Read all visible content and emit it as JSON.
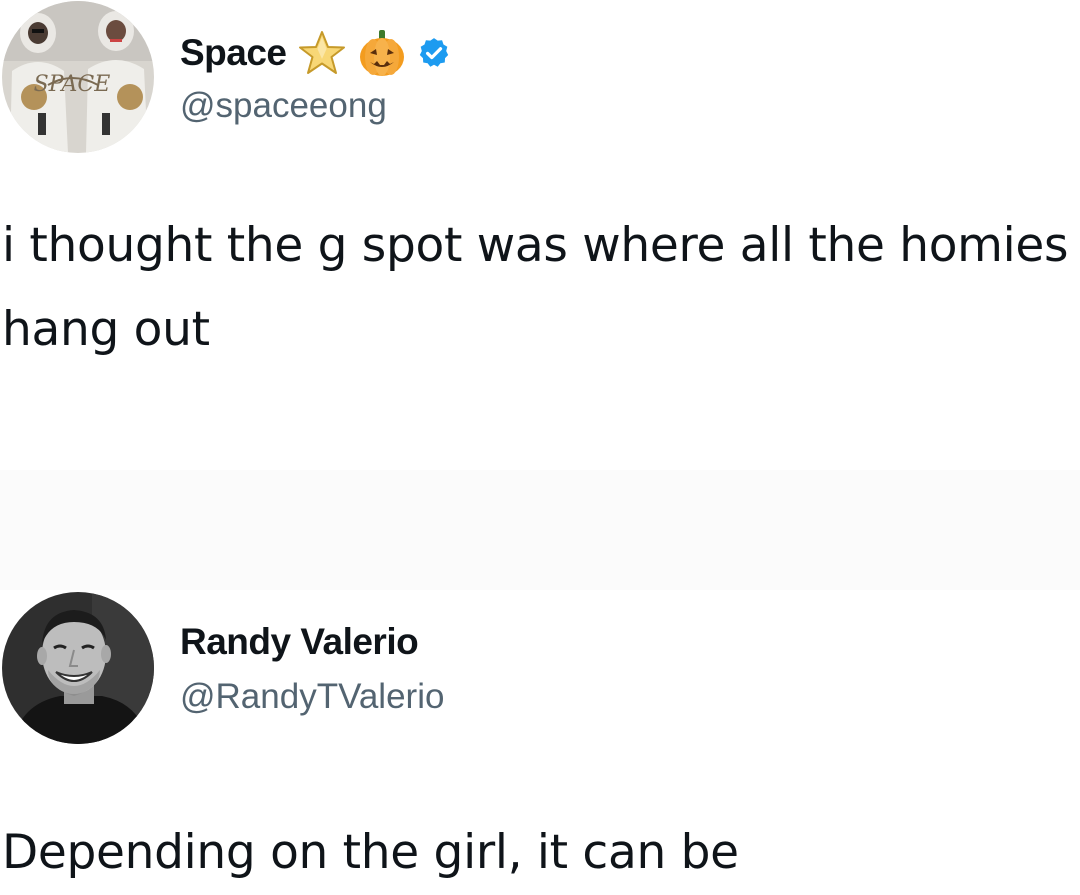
{
  "tweets": [
    {
      "display_name": "Space",
      "handle": "@spaceeong",
      "text": "i thought the g spot was where all the homies hang out",
      "name_icons": [
        "star-icon",
        "pumpkin-icon",
        "verified-badge-icon"
      ],
      "avatar_text": "SPACE"
    },
    {
      "display_name": "Randy Valerio",
      "handle": "@RandyTValerio",
      "text": "Depending on the girl, it can be"
    }
  ],
  "colors": {
    "verified": "#1d9bf0",
    "handle": "#536471",
    "text": "#0f1419"
  }
}
